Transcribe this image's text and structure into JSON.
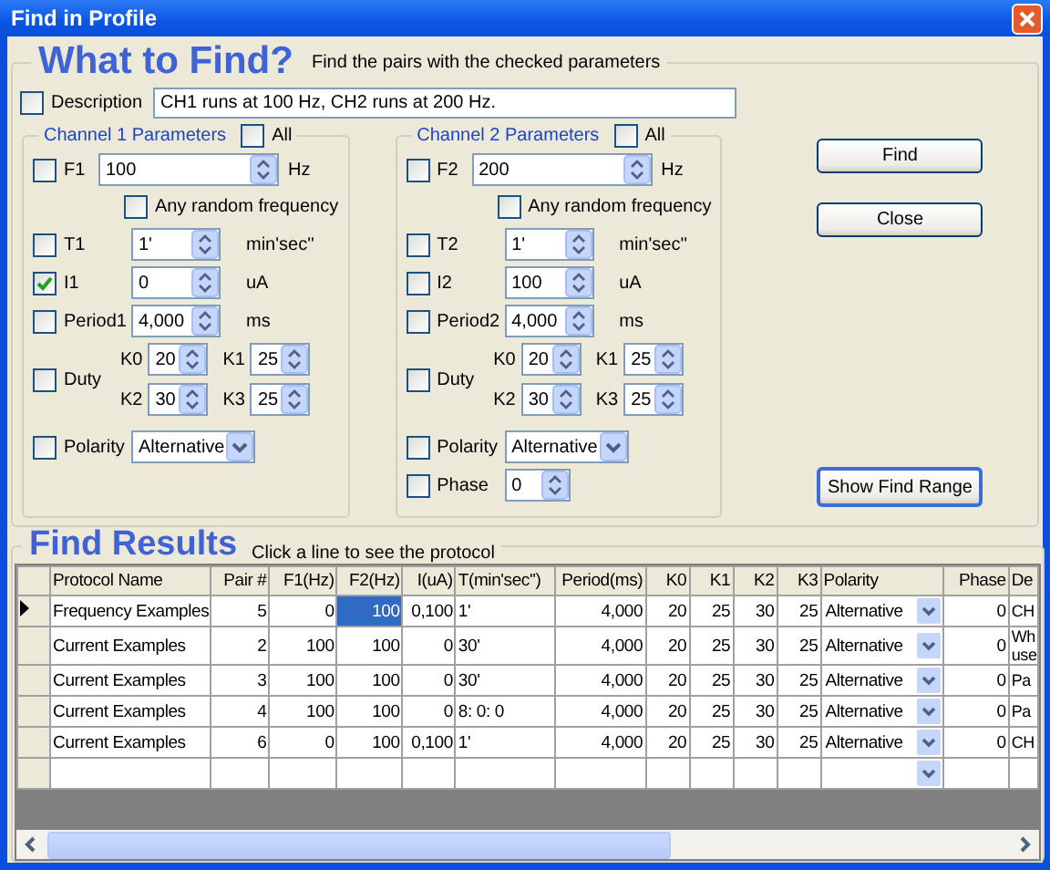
{
  "window": {
    "title": "Find in Profile"
  },
  "header": {
    "title": "What to Find?",
    "hint": "Find the pairs with the checked parameters"
  },
  "description": {
    "label": "Description",
    "checked": false,
    "value": "CH1 runs at 100 Hz, CH2 runs at 200 Hz."
  },
  "channels": [
    {
      "title": "Channel 1 Parameters",
      "all": {
        "label": "All",
        "checked": false
      },
      "rows": [
        {
          "kind": "freq",
          "label": "F1",
          "checked": false,
          "value": "100",
          "unit": "Hz"
        },
        {
          "kind": "check",
          "label": "Any random frequency",
          "checked": false
        },
        {
          "kind": "spin",
          "label": "T1",
          "checked": false,
          "value": "1'",
          "unit": "min'sec''"
        },
        {
          "kind": "spin",
          "label": "I1",
          "checked": true,
          "value": "0",
          "unit": "uA"
        },
        {
          "kind": "spin",
          "label": "Period1",
          "checked": false,
          "value": "4,000",
          "unit": "ms"
        },
        {
          "kind": "duty",
          "label": "Duty",
          "checked": false,
          "fields": [
            {
              "label": "K0",
              "value": "20"
            },
            {
              "label": "K1",
              "value": "25"
            },
            {
              "label": "K2",
              "value": "30"
            },
            {
              "label": "K3",
              "value": "25"
            }
          ]
        },
        {
          "kind": "dropdown",
          "label": "Polarity",
          "checked": false,
          "value": "Alternative"
        }
      ]
    },
    {
      "title": "Channel 2 Parameters",
      "all": {
        "label": "All",
        "checked": false
      },
      "rows": [
        {
          "kind": "freq",
          "label": "F2",
          "checked": false,
          "value": "200",
          "unit": "Hz"
        },
        {
          "kind": "check",
          "label": "Any random frequency",
          "checked": false
        },
        {
          "kind": "spin",
          "label": "T2",
          "checked": false,
          "value": "1'",
          "unit": "min'sec''"
        },
        {
          "kind": "spin",
          "label": "I2",
          "checked": false,
          "value": "100",
          "unit": "uA"
        },
        {
          "kind": "spin",
          "label": "Period2",
          "checked": false,
          "value": "4,000",
          "unit": "ms"
        },
        {
          "kind": "duty",
          "label": "Duty",
          "checked": false,
          "fields": [
            {
              "label": "K0",
              "value": "20"
            },
            {
              "label": "K1",
              "value": "25"
            },
            {
              "label": "K2",
              "value": "30"
            },
            {
              "label": "K3",
              "value": "25"
            }
          ]
        },
        {
          "kind": "dropdown",
          "label": "Polarity",
          "checked": false,
          "value": "Alternative"
        },
        {
          "kind": "spin",
          "label": "Phase",
          "checked": false,
          "value": "0"
        }
      ]
    }
  ],
  "buttons": [
    {
      "label": "Find",
      "default": false
    },
    {
      "label": "Close",
      "default": false
    },
    {
      "label": "Show Find Range",
      "default": true
    }
  ],
  "results": {
    "title": "Find Results",
    "hint": "Click a line to see the protocol",
    "columns": [
      {
        "label": "Protocol Name",
        "kind": "text"
      },
      {
        "label": "Pair #",
        "kind": "number"
      },
      {
        "label": "F1(Hz)",
        "kind": "number"
      },
      {
        "label": "F2(Hz)",
        "kind": "number"
      },
      {
        "label": "I(uA)",
        "kind": "number"
      },
      {
        "label": "T(min'sec'')",
        "kind": "text"
      },
      {
        "label": "Period(ms)",
        "kind": "number"
      },
      {
        "label": "K0",
        "kind": "number"
      },
      {
        "label": "K1",
        "kind": "number"
      },
      {
        "label": "K2",
        "kind": "number"
      },
      {
        "label": "K3",
        "kind": "number"
      },
      {
        "label": "Polarity",
        "kind": "dropdown"
      },
      {
        "label": "Phase",
        "kind": "number"
      },
      {
        "label": "De",
        "kind": "text"
      }
    ],
    "rows": [
      {
        "current": true,
        "cells": [
          {
            "text": "Frequency Examples",
            "selected": false
          },
          {
            "text": "5",
            "selected": false
          },
          {
            "text": "0",
            "selected": false
          },
          {
            "text": "100",
            "selected": true
          },
          {
            "text": "0,100",
            "selected": false
          },
          {
            "text": "1'",
            "selected": false
          },
          {
            "text": "4,000",
            "selected": false
          },
          {
            "text": "20",
            "selected": false
          },
          {
            "text": "25",
            "selected": false
          },
          {
            "text": "30",
            "selected": false
          },
          {
            "text": "25",
            "selected": false
          },
          {
            "text": "Alternative",
            "selected": false
          },
          {
            "text": "0",
            "selected": false
          },
          {
            "text": "CH",
            "selected": false
          }
        ]
      },
      {
        "current": false,
        "cells": [
          {
            "text": "Current Examples",
            "selected": false
          },
          {
            "text": "2",
            "selected": false
          },
          {
            "text": "100",
            "selected": false
          },
          {
            "text": "100",
            "selected": false
          },
          {
            "text": "0",
            "selected": false
          },
          {
            "text": "30'",
            "selected": false
          },
          {
            "text": "4,000",
            "selected": false
          },
          {
            "text": "20",
            "selected": false
          },
          {
            "text": "25",
            "selected": false
          },
          {
            "text": "30",
            "selected": false
          },
          {
            "text": "25",
            "selected": false
          },
          {
            "text": "Alternative",
            "selected": false
          },
          {
            "text": "0",
            "selected": false
          },
          {
            "text": "Wh\nuse",
            "selected": false
          }
        ]
      },
      {
        "current": false,
        "cells": [
          {
            "text": "Current Examples",
            "selected": false
          },
          {
            "text": "3",
            "selected": false
          },
          {
            "text": "100",
            "selected": false
          },
          {
            "text": "100",
            "selected": false
          },
          {
            "text": "0",
            "selected": false
          },
          {
            "text": "30'",
            "selected": false
          },
          {
            "text": "4,000",
            "selected": false
          },
          {
            "text": "20",
            "selected": false
          },
          {
            "text": "25",
            "selected": false
          },
          {
            "text": "30",
            "selected": false
          },
          {
            "text": "25",
            "selected": false
          },
          {
            "text": "Alternative",
            "selected": false
          },
          {
            "text": "0",
            "selected": false
          },
          {
            "text": "Pa",
            "selected": false
          }
        ]
      },
      {
        "current": false,
        "cells": [
          {
            "text": "Current Examples",
            "selected": false
          },
          {
            "text": "4",
            "selected": false
          },
          {
            "text": "100",
            "selected": false
          },
          {
            "text": "100",
            "selected": false
          },
          {
            "text": "0",
            "selected": false
          },
          {
            "text": "8: 0: 0",
            "selected": false
          },
          {
            "text": "4,000",
            "selected": false
          },
          {
            "text": "20",
            "selected": false
          },
          {
            "text": "25",
            "selected": false
          },
          {
            "text": "30",
            "selected": false
          },
          {
            "text": "25",
            "selected": false
          },
          {
            "text": "Alternative",
            "selected": false
          },
          {
            "text": "0",
            "selected": false
          },
          {
            "text": "Pa",
            "selected": false
          }
        ]
      },
      {
        "current": false,
        "cells": [
          {
            "text": "Current Examples",
            "selected": false
          },
          {
            "text": "6",
            "selected": false
          },
          {
            "text": "0",
            "selected": false
          },
          {
            "text": "100",
            "selected": false
          },
          {
            "text": "0,100",
            "selected": false
          },
          {
            "text": "1'",
            "selected": false
          },
          {
            "text": "4,000",
            "selected": false
          },
          {
            "text": "20",
            "selected": false
          },
          {
            "text": "25",
            "selected": false
          },
          {
            "text": "30",
            "selected": false
          },
          {
            "text": "25",
            "selected": false
          },
          {
            "text": "Alternative",
            "selected": false
          },
          {
            "text": "0",
            "selected": false
          },
          {
            "text": "CH",
            "selected": false
          }
        ]
      }
    ]
  }
}
